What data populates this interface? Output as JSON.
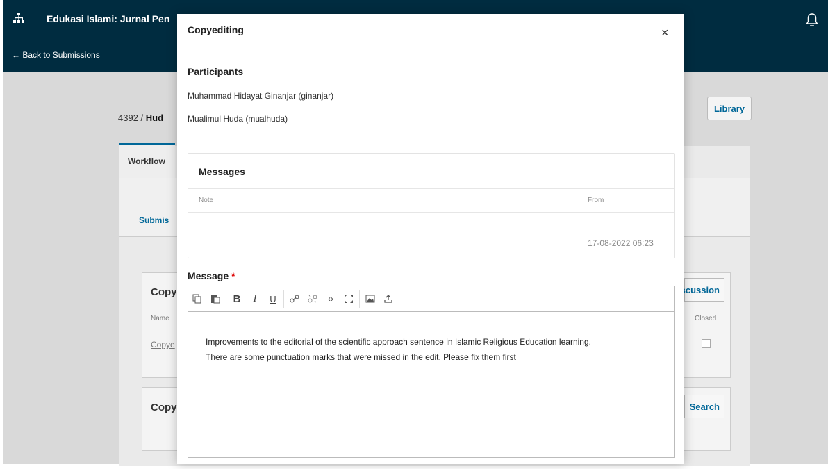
{
  "header": {
    "journal_title": "Edukasi Islami: Jurnal Pen",
    "back_label": "← Back to Submissions"
  },
  "submission": {
    "id": "4392",
    "separator": "/",
    "author_short": "Hud",
    "library_label": "Library"
  },
  "tabs": {
    "workflow_label": "Workflow",
    "submission_label": "Submis"
  },
  "background_cards": {
    "card1_title": "Copy",
    "card1_col_name": "Name",
    "card1_link": "Copye",
    "card1_button": "scussion",
    "card1_col_closed": "Closed",
    "card2_title": "Copy",
    "card2_button": "Search"
  },
  "modal": {
    "title": "Copyediting",
    "close_label": "×",
    "participants_heading": "Participants",
    "participants": [
      "Muhammad Hidayat Ginanjar (ginanjar)",
      "Mualimul Huda (mualhuda)"
    ],
    "messages": {
      "heading": "Messages",
      "col_note": "Note",
      "col_from": "From",
      "rows": [
        {
          "note": "",
          "from": "17-08-2022 06:23"
        }
      ]
    },
    "message_label": "Message",
    "required_mark": "*",
    "editor": {
      "toolbar_icons": [
        "copy-icon",
        "paste-icon",
        "bold-icon",
        "italic-icon",
        "underline-icon",
        "link-icon",
        "unlink-icon",
        "code-icon",
        "fullscreen-icon",
        "image-icon",
        "upload-icon"
      ],
      "toolbar_glyphs": {
        "bold": "B",
        "italic": "I",
        "underline": "U",
        "code": "‹›"
      },
      "text_line1": "Improvements to the editorial of the scientific approach sentence in Islamic Religious Education learning.",
      "text_line2": "There are some punctuation marks that were missed in the edit. Please fix them first"
    }
  },
  "colors": {
    "topbar": "#002c40",
    "accent": "#006798",
    "required": "#dd0000"
  }
}
